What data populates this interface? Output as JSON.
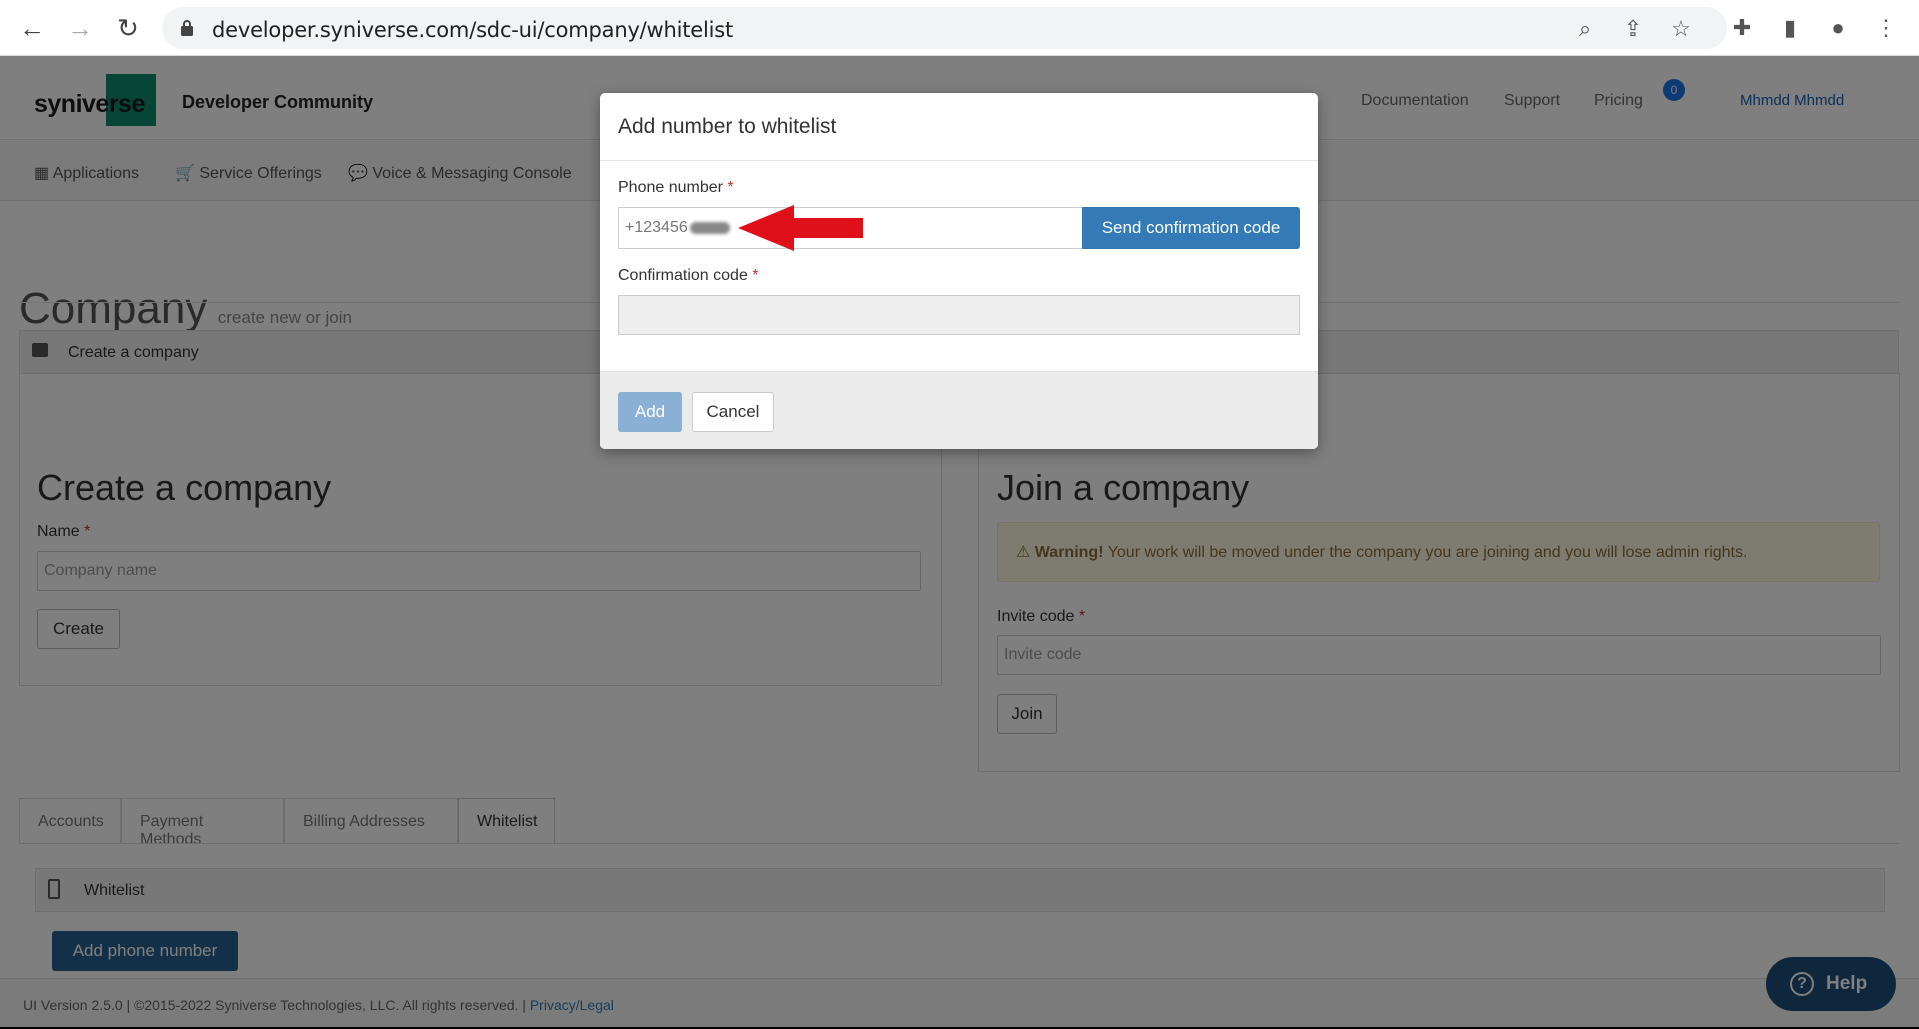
{
  "browser": {
    "url": "developer.syniverse.com/sdc-ui/company/whitelist"
  },
  "header": {
    "logo_text": "syniverse",
    "brand_title": "Developer Community",
    "nav": [
      "Documentation",
      "Support",
      "Pricing"
    ],
    "notification_count": "0",
    "user_name": "Mhmdd Mhmdd"
  },
  "subnav": {
    "items": [
      "Applications",
      "Service Offerings",
      "Voice & Messaging Console"
    ]
  },
  "page": {
    "title": "Company",
    "subtitle": "create new or join"
  },
  "panel": {
    "title": "Create a company"
  },
  "create": {
    "heading": "Create a company",
    "name_label": "Name",
    "name_placeholder": "Company name",
    "button": "Create"
  },
  "join": {
    "heading": "Join a company",
    "warning_bold": "Warning!",
    "warning_text": " Your work will be moved under the company you are joining and you will lose admin rights.",
    "invite_label": "Invite code",
    "invite_placeholder": "Invite code",
    "button": "Join"
  },
  "tabs": [
    "Accounts",
    "Payment Methods",
    "Billing Addresses",
    "Whitelist"
  ],
  "active_tab": "Whitelist",
  "whitelist": {
    "title": "Whitelist",
    "add_button": "Add phone number"
  },
  "footer": {
    "text": "UI Version 2.5.0 | ©2015-2022 Syniverse Technologies, LLC. All rights reserved. | ",
    "link": "Privacy/Legal"
  },
  "help": {
    "label": "Help"
  },
  "modal": {
    "title": "Add number to whitelist",
    "phone_label": "Phone number",
    "phone_value": "+123456",
    "send_button": "Send confirmation code",
    "code_label": "Confirmation code",
    "add_button": "Add",
    "cancel_button": "Cancel"
  },
  "colors": {
    "primary": "#337ab7",
    "primary_dark": "#286090",
    "brand_green": "#0f8a6d",
    "arrow": "#e0101a"
  }
}
